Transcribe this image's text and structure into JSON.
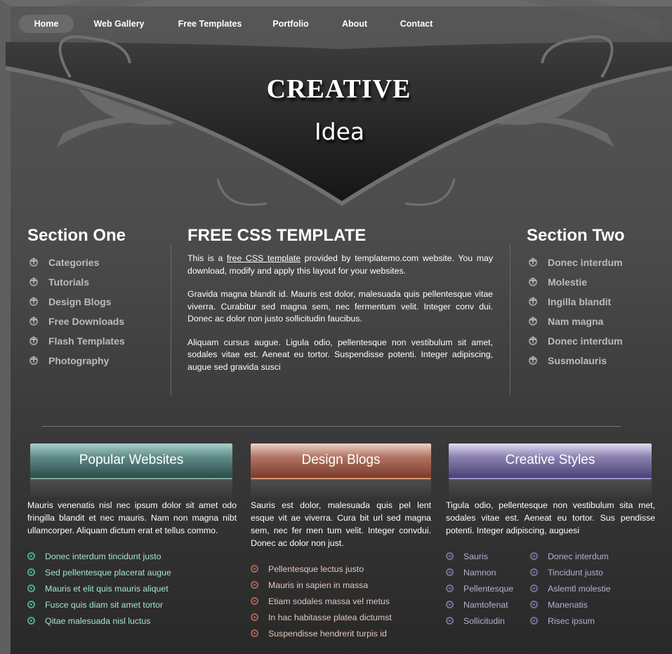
{
  "nav": [
    {
      "label": "Home",
      "active": true
    },
    {
      "label": "Web Gallery"
    },
    {
      "label": "Free Templates"
    },
    {
      "label": "Portfolio"
    },
    {
      "label": "About"
    },
    {
      "label": "Contact"
    }
  ],
  "header": {
    "title": "CREATIVE",
    "subtitle": "Idea"
  },
  "left": {
    "title": "Section One",
    "items": [
      "Categories",
      "Tutorials",
      "Design Blogs",
      "Free Downloads",
      "Flash Templates",
      "Photography"
    ]
  },
  "right": {
    "title": "Section Two",
    "items": [
      "Donec interdum",
      "Molestie",
      "Ingilla blandit",
      "Nam magna",
      "Donec interdum",
      "Susmolauris"
    ]
  },
  "center": {
    "title": "FREE CSS TEMPLATE",
    "p1_pre": "This is a ",
    "p1_link": "free CSS template",
    "p1_post": " provided by templatemo.com website. You may download, modify and apply this layout for your websites.",
    "p2": "Gravida magna blandit id. Mauris est dolor, malesuada quis pellentesque vitae viverra. Curabitur sed magna sem, nec fermentum velit. Integer conv dui. Donec ac dolor non justo sollicitudin faucibus.",
    "p3": "Aliquam cursus augue. Ligula odio, pellentesque non vestibulum sit amet, sodales vitae est. Aeneat eu tortor. Suspendisse potenti. Integer adipiscing, augue sed gravida susci"
  },
  "boxes": [
    {
      "title": "Popular Websites",
      "text": "Mauris venenatis nisl nec ipsum dolor sit amet odo fringilla blandit et nec mauris. Nam non magna nibt ullamcorper. Aliquam dictum erat et tellus commo.",
      "items": [
        "Donec interdum tincidunt justo",
        "Sed pellentesque placerat augue",
        "Mauris et elit quis mauris aliquet",
        "Fusce quis diam sit amet tortor",
        "Qitae malesuada nisl luctus"
      ]
    },
    {
      "title": "Design Blogs",
      "text": "Sauris est dolor, malesuada quis pel lent esque vit ae viverra. Cura bit url sed magna sem, nec fer men tum velit. Integer convdui. Donec ac dolor non just.",
      "items": [
        "Pellentesque lectus justo",
        "Mauris in sapien in massa",
        "Etiam sodales massa vel metus",
        "In hac habitasse platea dictumst",
        "Suspendisse hendrerit turpis id"
      ]
    },
    {
      "title": "Creative Styles",
      "text": "Tigula odio, pellentesque non vestibulum sita met, sodales vitae est. Aeneat eu tortor. Sus pendisse potenti. Integer adipiscing, auguesi",
      "items_a": [
        "Sauris",
        "Namnon",
        "Pellentesque",
        "Namtofenat",
        "Sollicitudin"
      ],
      "items_b": [
        "Donec interdum",
        "Tincidunt justo",
        "Aslemtl molestie",
        "Manenatis",
        "Risec ipsum"
      ]
    }
  ],
  "colors": {
    "teal": "#4fa89a",
    "rust": "#a46550",
    "purple": "#7a6f9e"
  }
}
